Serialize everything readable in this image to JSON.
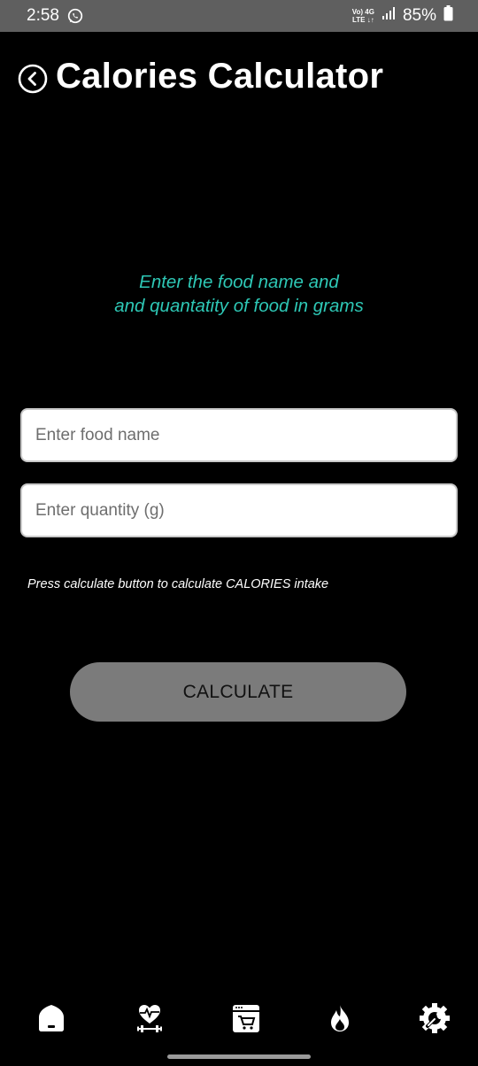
{
  "status_bar": {
    "time": "2:58",
    "network_top": "Vo) 4G",
    "network_bottom": "LTE ↓↑",
    "battery_percent": "85%"
  },
  "header": {
    "title": "Calories Calculator"
  },
  "instruction": {
    "line1": "Enter the food name and",
    "line2": "and quantatity of food in grams"
  },
  "form": {
    "food_placeholder": "Enter food name",
    "food_value": "",
    "quantity_placeholder": "Enter quantity (g)",
    "quantity_value": ""
  },
  "hint": "Press calculate button to calculate CALORIES intake",
  "calculate_label": "CALCULATE",
  "colors": {
    "accent": "#2ec8b6",
    "background": "#000000",
    "button": "#7b7b7b"
  },
  "bottom_nav": {
    "items": [
      "home-icon",
      "fitness-icon",
      "shop-icon",
      "fire-icon",
      "settings-icon"
    ]
  }
}
